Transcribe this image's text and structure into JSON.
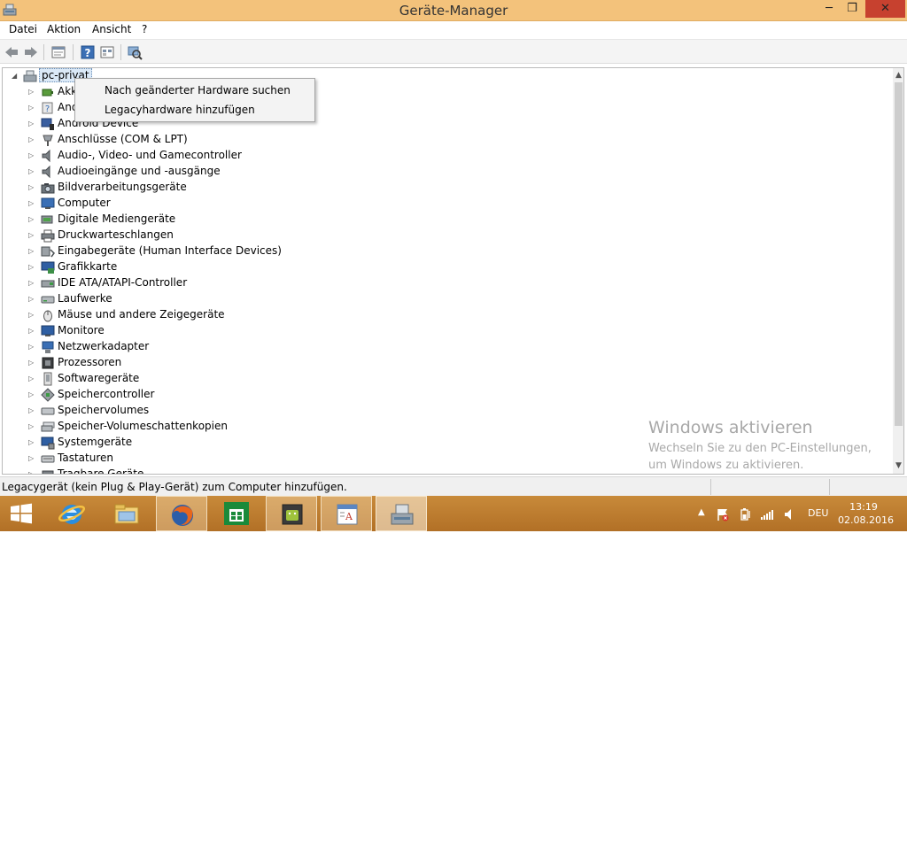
{
  "window": {
    "title": "Geräte-Manager",
    "minimize_glyph": "─",
    "maximize_glyph": "❐",
    "close_glyph": "✕"
  },
  "menubar": {
    "items": [
      "Datei",
      "Aktion",
      "Ansicht",
      "?"
    ]
  },
  "toolbar": {
    "buttons": [
      "back-arrow-icon",
      "forward-arrow-icon",
      "properties-icon",
      "help-icon",
      "details-view-icon",
      "scan-hardware-icon"
    ]
  },
  "tree": {
    "root": {
      "label": "pc-privat"
    },
    "items": [
      {
        "label": "Akkus",
        "icon": "battery-icon"
      },
      {
        "label": "Andere Geräte",
        "icon": "unknown-device-icon"
      },
      {
        "label": "Android Device",
        "icon": "android-device-icon"
      },
      {
        "label": "Anschlüsse (COM & LPT)",
        "icon": "port-icon"
      },
      {
        "label": "Audio-, Video- und Gamecontroller",
        "icon": "speaker-icon"
      },
      {
        "label": "Audioeingänge und -ausgänge",
        "icon": "speaker-icon"
      },
      {
        "label": "Bildverarbeitungsgeräte",
        "icon": "camera-icon"
      },
      {
        "label": "Computer",
        "icon": "computer-icon"
      },
      {
        "label": "Digitale Mediengeräte",
        "icon": "media-device-icon"
      },
      {
        "label": "Druckwarteschlangen",
        "icon": "printer-icon"
      },
      {
        "label": "Eingabegeräte (Human Interface Devices)",
        "icon": "hid-icon"
      },
      {
        "label": "Grafikkarte",
        "icon": "display-adapter-icon"
      },
      {
        "label": "IDE ATA/ATAPI-Controller",
        "icon": "ide-controller-icon"
      },
      {
        "label": "Laufwerke",
        "icon": "drive-icon"
      },
      {
        "label": "Mäuse und andere Zeigegeräte",
        "icon": "mouse-icon"
      },
      {
        "label": "Monitore",
        "icon": "monitor-icon"
      },
      {
        "label": "Netzwerkadapter",
        "icon": "network-adapter-icon"
      },
      {
        "label": "Prozessoren",
        "icon": "processor-icon"
      },
      {
        "label": "Softwaregeräte",
        "icon": "software-device-icon"
      },
      {
        "label": "Speichercontroller",
        "icon": "storage-controller-icon"
      },
      {
        "label": "Speichervolumes",
        "icon": "volume-icon"
      },
      {
        "label": "Speicher-Volumeschattenkopien",
        "icon": "shadow-copy-icon"
      },
      {
        "label": "Systemgeräte",
        "icon": "system-device-icon"
      },
      {
        "label": "Tastaturen",
        "icon": "keyboard-icon"
      },
      {
        "label": "Tragbare Geräte",
        "icon": "portable-device-icon"
      }
    ]
  },
  "context_menu": {
    "items": [
      "Nach geänderter Hardware suchen",
      "Legacyhardware hinzufügen"
    ]
  },
  "watermark": {
    "title": "Windows aktivieren",
    "line1": "Wechseln Sie zu den PC-Einstellungen,",
    "line2": "um Windows zu aktivieren."
  },
  "statusbar": {
    "text": "Legacygerät (kein Plug & Play-Gerät) zum Computer hinzufügen."
  },
  "taskbar": {
    "apps": [
      "internet-explorer-icon",
      "file-explorer-icon",
      "firefox-icon",
      "store-icon",
      "android-app-icon",
      "document-app-icon",
      "device-manager-icon"
    ],
    "language": "DEU",
    "time": "13:19",
    "date": "02.08.2016"
  },
  "colors": {
    "titlebar": "#f3c27b",
    "close_button": "#c7412f",
    "taskbar": "#b97a2e"
  }
}
